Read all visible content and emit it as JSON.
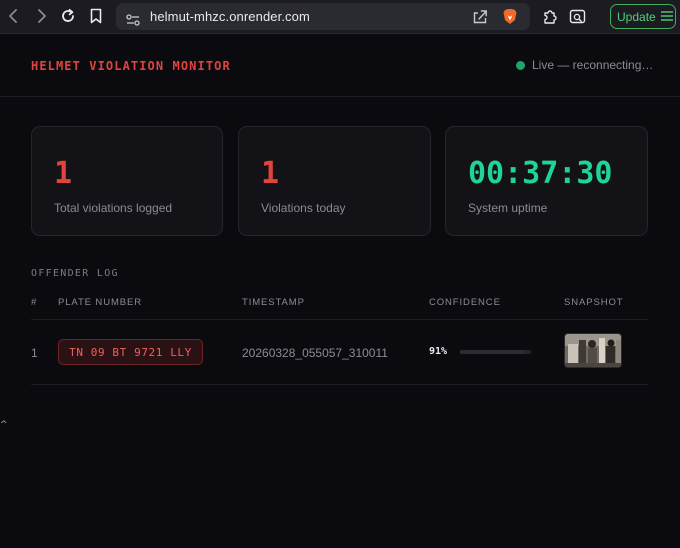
{
  "browser": {
    "url": "helmut-mhzc.onrender.com",
    "update_label": "Update"
  },
  "header": {
    "title": "HELMET VIOLATION MONITOR",
    "status": "Live — reconnecting…"
  },
  "stats": [
    {
      "value": "1",
      "label": "Total violations logged"
    },
    {
      "value": "1",
      "label": "Violations today"
    },
    {
      "value": "00:37:30",
      "label": "System uptime"
    }
  ],
  "log": {
    "title": "OFFENDER LOG",
    "columns": {
      "index": "#",
      "plate": "PLATE NUMBER",
      "timestamp": "TIMESTAMP",
      "confidence": "CONFIDENCE",
      "snapshot": "SNAPSHOT"
    },
    "rows": [
      {
        "index": "1",
        "plate": "TN 09 BT 9721 LLY",
        "timestamp": "20260328_055057_310011",
        "confidence_label": "91%",
        "confidence": 0.91
      }
    ]
  },
  "colors": {
    "accent_red": "#e2433e",
    "accent_green": "#1fd497",
    "live_dot": "#1fa56c",
    "update_green": "#4fd07a"
  }
}
